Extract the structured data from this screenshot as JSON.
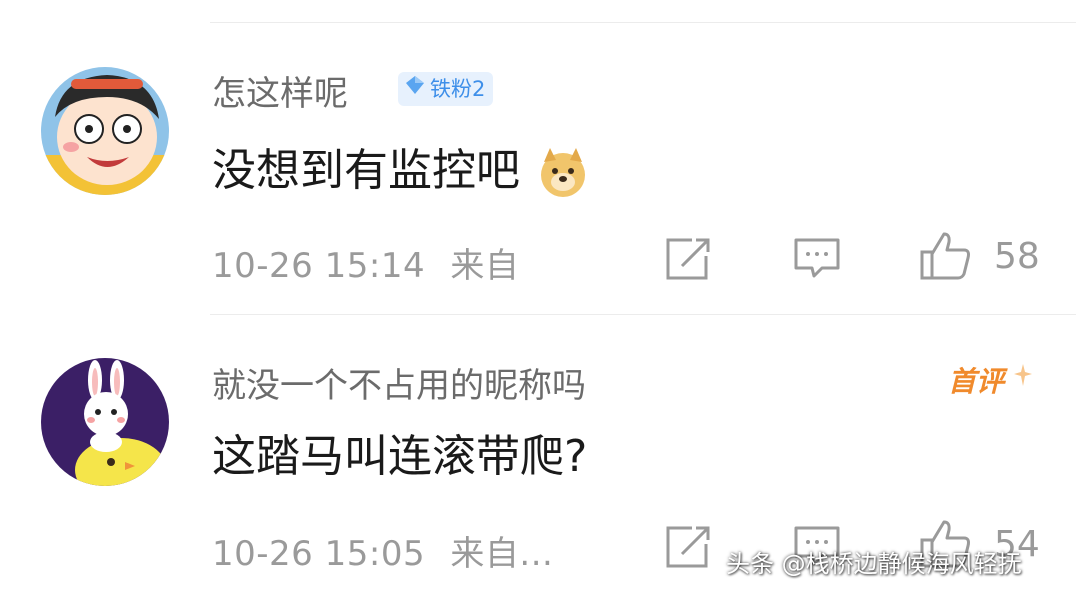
{
  "comments": [
    {
      "username": "怎这样呢",
      "badge": "铁粉2",
      "text": "没想到有监控吧",
      "emoji": "doge-emoji",
      "time": "10-26 15:14",
      "source": "来自",
      "likes": "58"
    },
    {
      "username": "就没一个不占用的昵称吗",
      "tag": "首评",
      "text": "这踏马叫连滚带爬?",
      "time": "10-26 15:05",
      "source": "来自...",
      "likes": "54"
    }
  ],
  "watermark": "头条 @栈桥边静候海风轻抚",
  "colors": {
    "text_primary": "#1a1a1a",
    "text_secondary": "#6b6b6b",
    "meta": "#9a9a9a",
    "badge_blue": "#3e8fe9",
    "first_tag_orange": "#f08a2c"
  },
  "icons": [
    "share-icon",
    "reply-icon",
    "like-icon",
    "diamond-icon"
  ]
}
